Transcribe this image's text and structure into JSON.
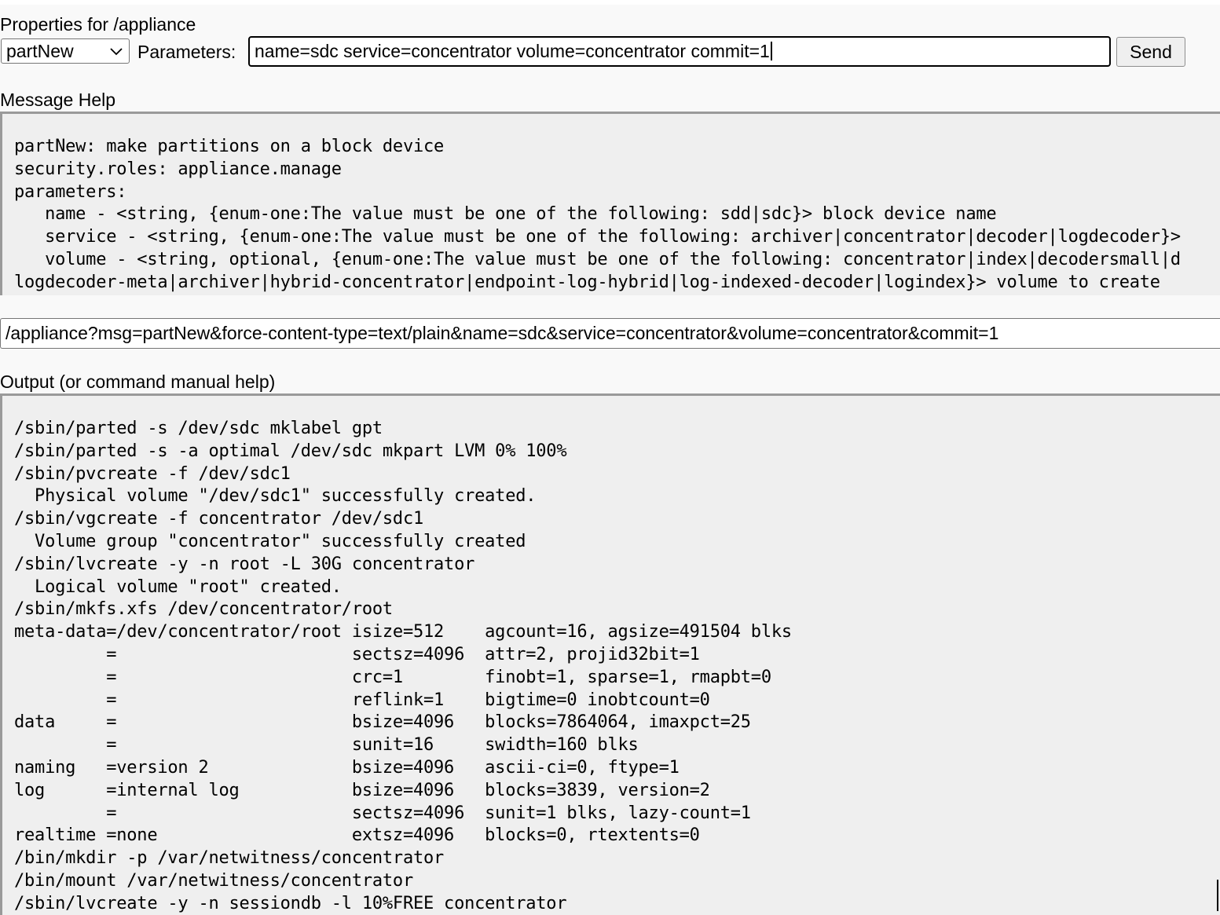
{
  "header": {
    "title": "Properties for /appliance"
  },
  "form": {
    "message_select": {
      "selected": "partNew"
    },
    "parameters_label": "Parameters:",
    "parameters_value": "name=sdc service=concentrator volume=concentrator commit=1",
    "send_label": "Send"
  },
  "help": {
    "heading": "Message Help",
    "text": "partNew: make partitions on a block device\nsecurity.roles: appliance.manage\nparameters:\n   name - <string, {enum-one:The value must be one of the following: sdd|sdc}> block device name\n   service - <string, {enum-one:The value must be one of the following: archiver|concentrator|decoder|logdecoder}> \n   volume - <string, optional, {enum-one:The value must be one of the following: concentrator|index|decodersmall|d\nlogdecoder-meta|archiver|hybrid-concentrator|endpoint-log-hybrid|log-indexed-decoder|logindex}> volume to create"
  },
  "url": {
    "value": "/appliance?msg=partNew&force-content-type=text/plain&name=sdc&service=concentrator&volume=concentrator&commit=1"
  },
  "output": {
    "heading": "Output (or command manual help)",
    "text": "/sbin/parted -s /dev/sdc mklabel gpt\n/sbin/parted -s -a optimal /dev/sdc mkpart LVM 0% 100%\n/sbin/pvcreate -f /dev/sdc1\n  Physical volume \"/dev/sdc1\" successfully created.\n/sbin/vgcreate -f concentrator /dev/sdc1\n  Volume group \"concentrator\" successfully created\n/sbin/lvcreate -y -n root -L 30G concentrator\n  Logical volume \"root\" created.\n/sbin/mkfs.xfs /dev/concentrator/root\nmeta-data=/dev/concentrator/root isize=512    agcount=16, agsize=491504 blks\n         =                       sectsz=4096  attr=2, projid32bit=1\n         =                       crc=1        finobt=1, sparse=1, rmapbt=0\n         =                       reflink=1    bigtime=0 inobtcount=0\ndata     =                       bsize=4096   blocks=7864064, imaxpct=25\n         =                       sunit=16     swidth=160 blks\nnaming   =version 2              bsize=4096   ascii-ci=0, ftype=1\nlog      =internal log           bsize=4096   blocks=3839, version=2\n         =                       sectsz=4096  sunit=1 blks, lazy-count=1\nrealtime =none                   extsz=4096   blocks=0, rtextents=0\n/bin/mkdir -p /var/netwitness/concentrator\n/bin/mount /var/netwitness/concentrator\n/sbin/lvcreate -y -n sessiondb -l 10%FREE concentrator"
  },
  "icons": {
    "select_chevron": "chevron-down-icon"
  }
}
